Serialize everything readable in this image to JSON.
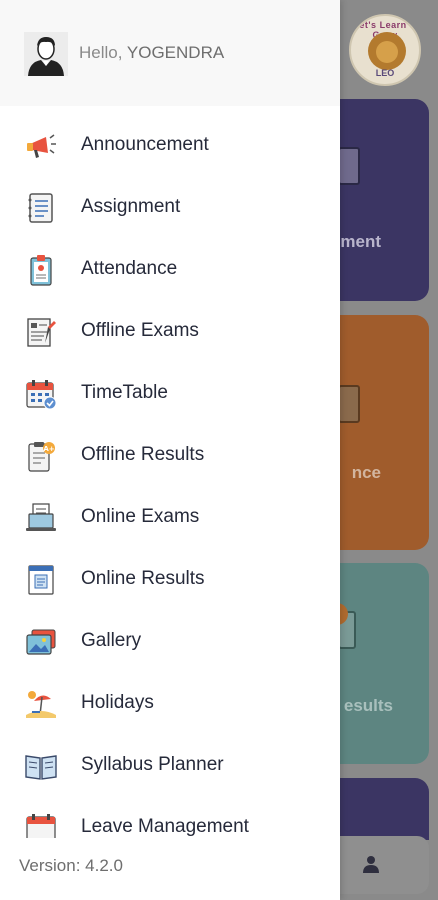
{
  "background_app": {
    "logo": {
      "top_text": "Let's Learn & Grow",
      "bottom_text": "LEO"
    },
    "cards": [
      {
        "label": "ment",
        "color": "#3b3563"
      },
      {
        "label": "nce",
        "color": "#a05c2c"
      },
      {
        "label": "esults",
        "color": "#5d8581"
      }
    ],
    "tabbar": {
      "icon": "user-icon"
    }
  },
  "drawer": {
    "header": {
      "greeting_prefix": "Hello, ",
      "user_name": "YOGENDRA",
      "avatar_icon": "user-avatar-icon"
    },
    "menu": [
      {
        "label": "Announcement",
        "icon": "megaphone-icon"
      },
      {
        "label": "Assignment",
        "icon": "notebook-icon"
      },
      {
        "label": "Attendance",
        "icon": "clipboard-icon"
      },
      {
        "label": "Offline Exams",
        "icon": "exam-paper-icon"
      },
      {
        "label": "TimeTable",
        "icon": "calendar-icon"
      },
      {
        "label": "Offline Results",
        "icon": "report-card-icon"
      },
      {
        "label": "Online Exams",
        "icon": "laptop-exam-icon"
      },
      {
        "label": "Online Results",
        "icon": "online-result-icon"
      },
      {
        "label": "Gallery",
        "icon": "gallery-icon"
      },
      {
        "label": "Holidays",
        "icon": "beach-icon"
      },
      {
        "label": "Syllabus Planner",
        "icon": "book-icon"
      },
      {
        "label": "Leave Management",
        "icon": "leave-calendar-icon"
      }
    ],
    "version": "Version: 4.2.0"
  },
  "colors": {
    "drawer_bg": "#ffffff",
    "header_bg": "#f8f8f8",
    "menu_text": "#262a3a",
    "overlay": "#8a8a8a"
  }
}
